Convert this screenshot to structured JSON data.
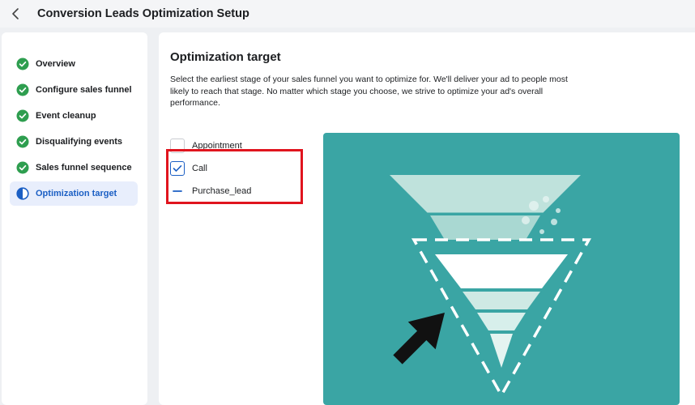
{
  "header": {
    "title": "Conversion Leads Optimization Setup",
    "back_icon": "chevron-left-icon"
  },
  "sidebar": {
    "steps": [
      {
        "label": "Overview",
        "status": "complete"
      },
      {
        "label": "Configure sales funnel",
        "status": "complete"
      },
      {
        "label": "Event cleanup",
        "status": "complete"
      },
      {
        "label": "Disqualifying events",
        "status": "complete"
      },
      {
        "label": "Sales funnel sequence",
        "status": "complete"
      },
      {
        "label": "Optimization target",
        "status": "in-progress"
      }
    ]
  },
  "main": {
    "title": "Optimization target",
    "description": "Select the earliest stage of your sales funnel you want to optimize for. We'll deliver your ad to people most likely to reach that stage. No matter which stage you choose, we strive to optimize your ad's overall performance.",
    "options": [
      {
        "label": "Appointment",
        "state": "unchecked"
      },
      {
        "label": "Call",
        "state": "checked"
      },
      {
        "label": "Purchase_lead",
        "state": "indeterminate"
      }
    ]
  },
  "colors": {
    "complete": "#2e9e4f",
    "active": "#1b5fc4",
    "illustration_bg": "#3aa5a4",
    "highlight": "#e0141e"
  }
}
